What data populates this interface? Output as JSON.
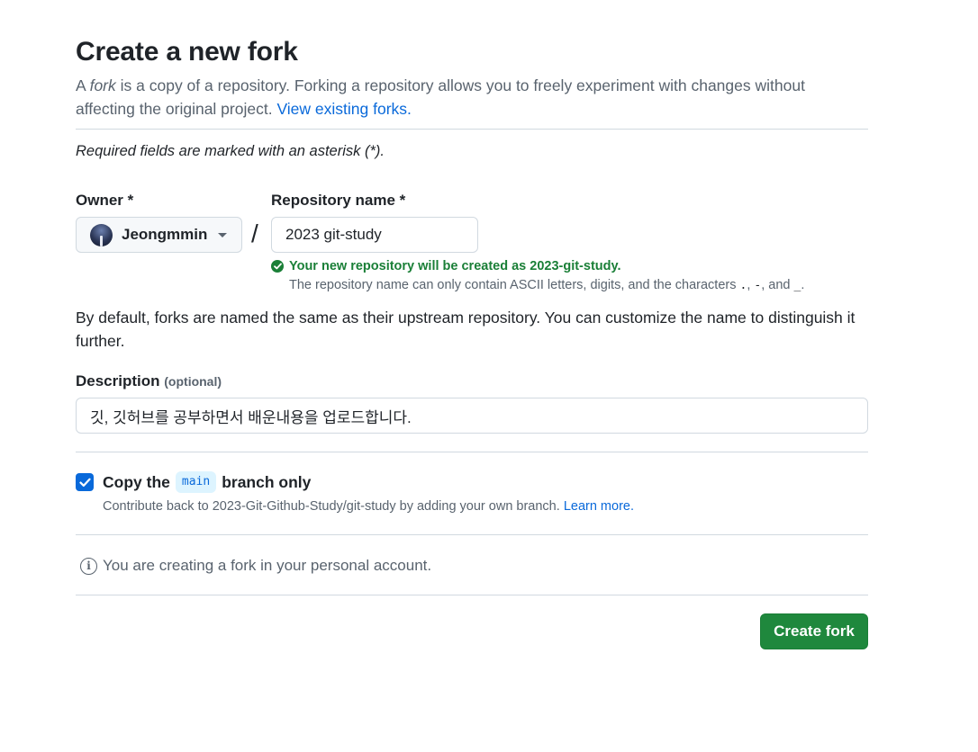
{
  "page": {
    "title": "Create a new fork",
    "lead_prefix": "A ",
    "lead_fork_word": "fork",
    "lead_rest": " is a copy of a repository. Forking a repository allows you to freely experiment with changes without affecting the original project. ",
    "lead_link": "View existing forks."
  },
  "form": {
    "required_note": "Required fields are marked with an asterisk (*).",
    "owner_label": "Owner *",
    "owner_value": "Jeongmmin",
    "slash": "/",
    "repo_label": "Repository name *",
    "repo_value": "2023 git-study",
    "success_message": "Your new repository will be created as 2023-git-study.",
    "hint_prefix": "The repository name can only contain ASCII letters, digits, and the characters ",
    "hint_chars_1": ".",
    "hint_sep_1": ", ",
    "hint_chars_2": "-",
    "hint_sep_2": ", and ",
    "hint_chars_3": "_",
    "hint_suffix": ".",
    "default_note": "By default, forks are named the same as their upstream repository. You can customize the name to distinguish it further.",
    "description_label": "Description",
    "description_optional": "(optional)",
    "description_value": "깃, 깃허브를 공부하면서 배운내용을 업로드합니다.",
    "copy_prefix": "Copy the",
    "copy_branch": "main",
    "copy_suffix": "branch only",
    "copy_checked": true,
    "contribute_text": "Contribute back to 2023-Git-Github-Study/git-study by adding your own branch. ",
    "contribute_link": "Learn more.",
    "info_text": "You are creating a fork in your personal account.",
    "submit_label": "Create fork"
  },
  "colors": {
    "link": "#0969da",
    "success": "#1a7f37",
    "primary_button": "#1f883d",
    "muted_text": "#59636e",
    "border": "#d1d9e0"
  },
  "icons": {
    "owner_avatar": "avatar",
    "owner_dropdown": "triangle-down-icon",
    "success": "check-circle-fill-icon",
    "checkbox": "checkbox-checked-icon",
    "info": "info-icon"
  }
}
